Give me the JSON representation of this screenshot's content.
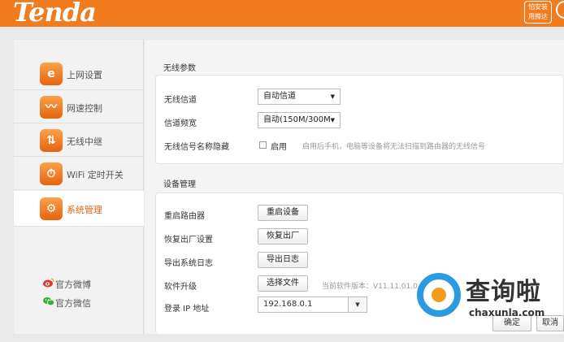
{
  "header": {
    "logo": "Tenda",
    "badge_line1": "怕安装",
    "badge_line2": "用腾达"
  },
  "sidebar": {
    "items": [
      {
        "label": "上网设置",
        "icon": "e"
      },
      {
        "label": "网速控制",
        "icon": "〰"
      },
      {
        "label": "无线中继",
        "icon": "⇅"
      },
      {
        "label": "WiFi 定时开关",
        "icon": "⏱"
      },
      {
        "label": "系统管理",
        "icon": "⚙"
      }
    ],
    "social": [
      {
        "label": "官方微博",
        "icon": "weibo-icon"
      },
      {
        "label": "官方微信",
        "icon": "wechat-icon"
      }
    ]
  },
  "wireless": {
    "title": "无线参数",
    "channel_label": "无线信道",
    "channel_value": "自动信道",
    "bandwidth_label": "信道频宽",
    "bandwidth_value": "自动(150M/300M",
    "hide_ssid_label": "无线信号名称隐藏",
    "hide_ssid_option": "启用",
    "hide_ssid_checked": false,
    "hide_ssid_hint": "启用后手机，电脑等设备将无法扫描到路由器的无线信号"
  },
  "device": {
    "title": "设备管理",
    "reboot_label": "重启路由器",
    "reboot_button": "重启设备",
    "reset_label": "恢复出厂设置",
    "reset_button": "恢复出厂",
    "log_label": "导出系统日志",
    "log_button": "导出日志",
    "upgrade_label": "软件升级",
    "upgrade_button": "选择文件",
    "version_text": "当前软件版本：V11.11.01.0",
    "login_ip_label": "登录 IP 地址",
    "login_ip_value": "192.168.0.1"
  },
  "footer": {
    "ok_label": "确定",
    "cancel_label": "取消"
  },
  "watermark": {
    "big": "查询啦",
    "small": "chaxunla.com"
  },
  "colors": {
    "brand": "#f07c1f",
    "active_text": "#e8620f"
  }
}
